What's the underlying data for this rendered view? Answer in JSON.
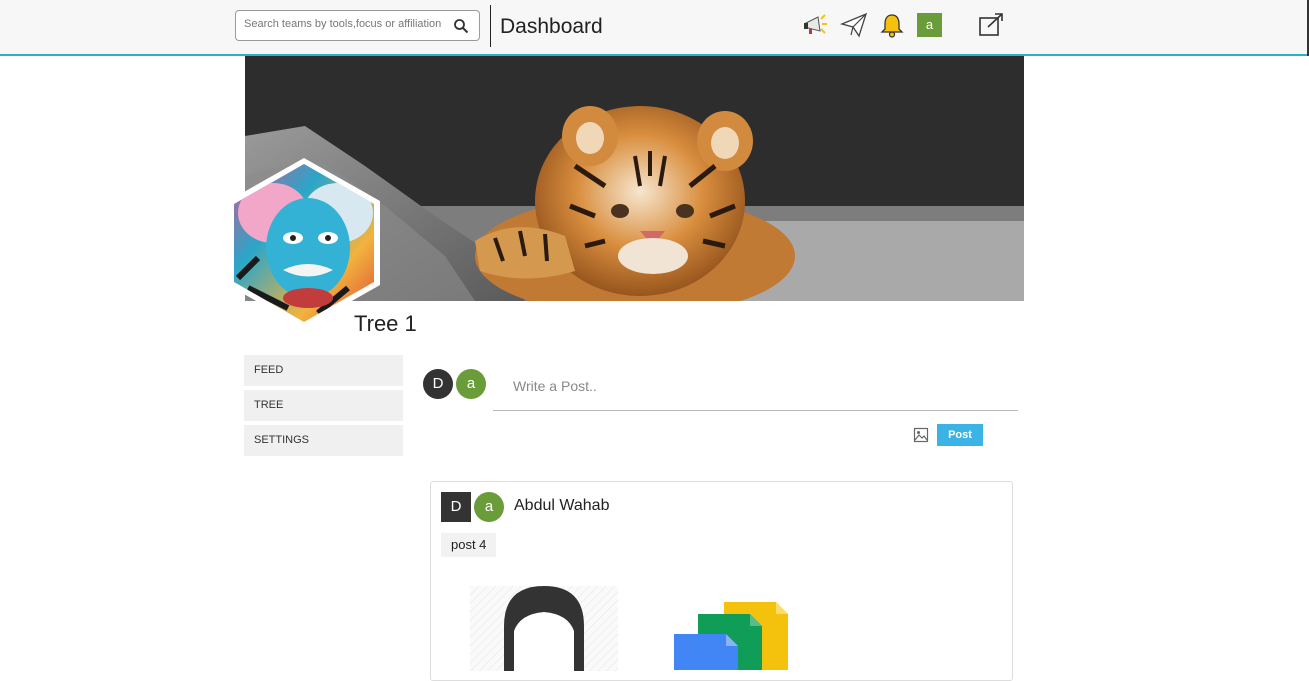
{
  "header": {
    "search_placeholder": "Search teams by tools,focus or affiliation",
    "title": "Dashboard",
    "avatar_letter": "a",
    "icons": [
      "search-icon",
      "megaphone-icon",
      "paper-plane-icon",
      "bell-icon",
      "external-link-icon"
    ]
  },
  "team": {
    "name": "Tree 1",
    "banner": "tiger-cub-banner",
    "logo": "hexagon-portrait-logo"
  },
  "menu": {
    "items": [
      {
        "label": "FEED"
      },
      {
        "label": "TREE"
      },
      {
        "label": "SETTINGS"
      }
    ]
  },
  "composer": {
    "avatar_dark_letter": "D",
    "avatar_green_letter": "a",
    "placeholder": "Write a Post..",
    "post_label": "Post"
  },
  "post": {
    "avatar_dark_letter": "D",
    "avatar_green_letter": "a",
    "author": "Abdul Wahab",
    "text": "post 4"
  },
  "colors": {
    "accent": "#2ab3c6",
    "post_button": "#3bb4e5",
    "avatar_green": "#6a9d3a",
    "avatar_dark": "#333333"
  }
}
